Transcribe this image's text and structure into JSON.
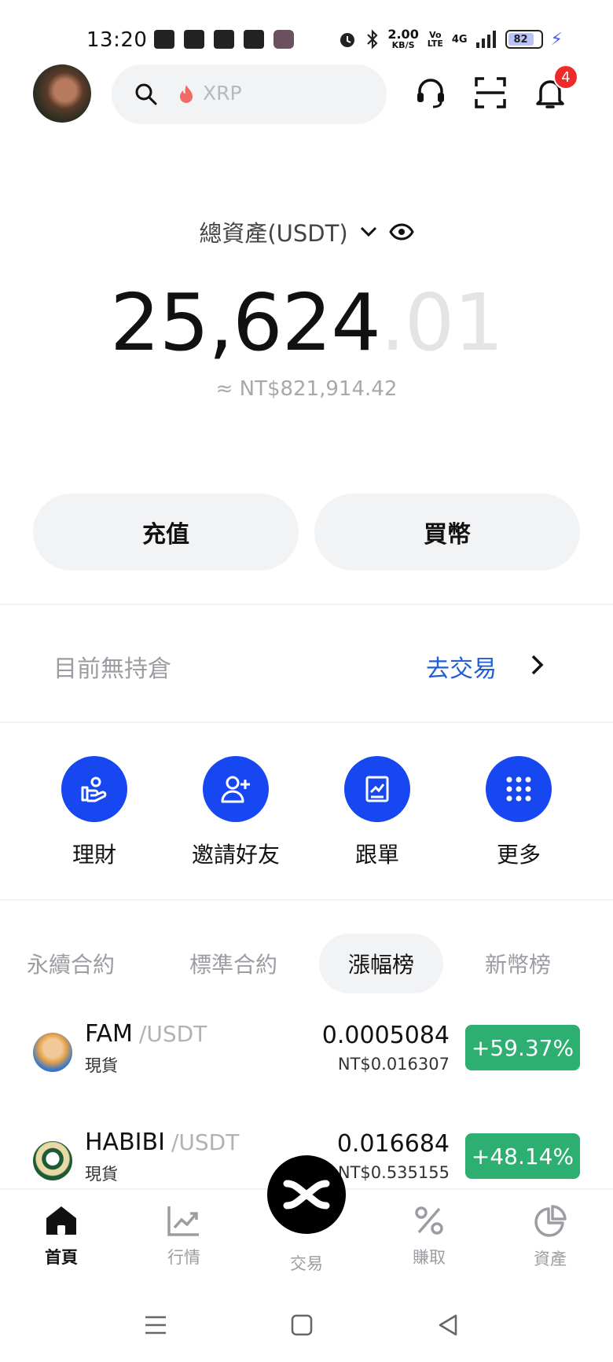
{
  "status_bar": {
    "time": "13:20",
    "net_speed_value": "2.00",
    "net_speed_unit": "KB/S",
    "volte": "Vo LTE",
    "network": "4G",
    "battery": "82"
  },
  "header": {
    "search_placeholder": "XRP",
    "notification_count": "4"
  },
  "balance": {
    "label": "總資產(USDT)",
    "amount_int": "25,624",
    "amount_dec": ".01",
    "fiat": "≈ NT$821,914.42"
  },
  "actions": {
    "deposit": "充值",
    "buy": "買幣"
  },
  "positions": {
    "empty_text": "目前無持倉",
    "go_trade": "去交易"
  },
  "shortcuts": [
    {
      "label": "理財",
      "icon": "finance-hand-icon"
    },
    {
      "label": "邀請好友",
      "icon": "invite-user-icon"
    },
    {
      "label": "跟單",
      "icon": "copy-trade-icon"
    },
    {
      "label": "更多",
      "icon": "grid-dots-icon"
    }
  ],
  "tabs": [
    {
      "label": "永續合約",
      "active": false
    },
    {
      "label": "標準合約",
      "active": false
    },
    {
      "label": "漲幅榜",
      "active": true
    },
    {
      "label": "新幣榜",
      "active": false
    }
  ],
  "list": [
    {
      "base": "FAM",
      "quote": "/USDT",
      "type": "現貨",
      "price": "0.0005084",
      "fiat": "NT$0.016307",
      "change": "+59.37%"
    },
    {
      "base": "HABIBI",
      "quote": "/USDT",
      "type": "現貨",
      "price": "0.016684",
      "fiat": "NT$0.535155",
      "change": "+48.14%"
    }
  ],
  "bottom_nav": [
    {
      "label": "首頁",
      "active": true
    },
    {
      "label": "行情",
      "active": false
    },
    {
      "label": "交易",
      "active": false
    },
    {
      "label": "賺取",
      "active": false
    },
    {
      "label": "資產",
      "active": false
    }
  ],
  "colors": {
    "accent_blue": "#1747f0",
    "link_blue": "#1f5fd1",
    "gain_green": "#2eaf72",
    "badge_red": "#ef2a2a"
  }
}
